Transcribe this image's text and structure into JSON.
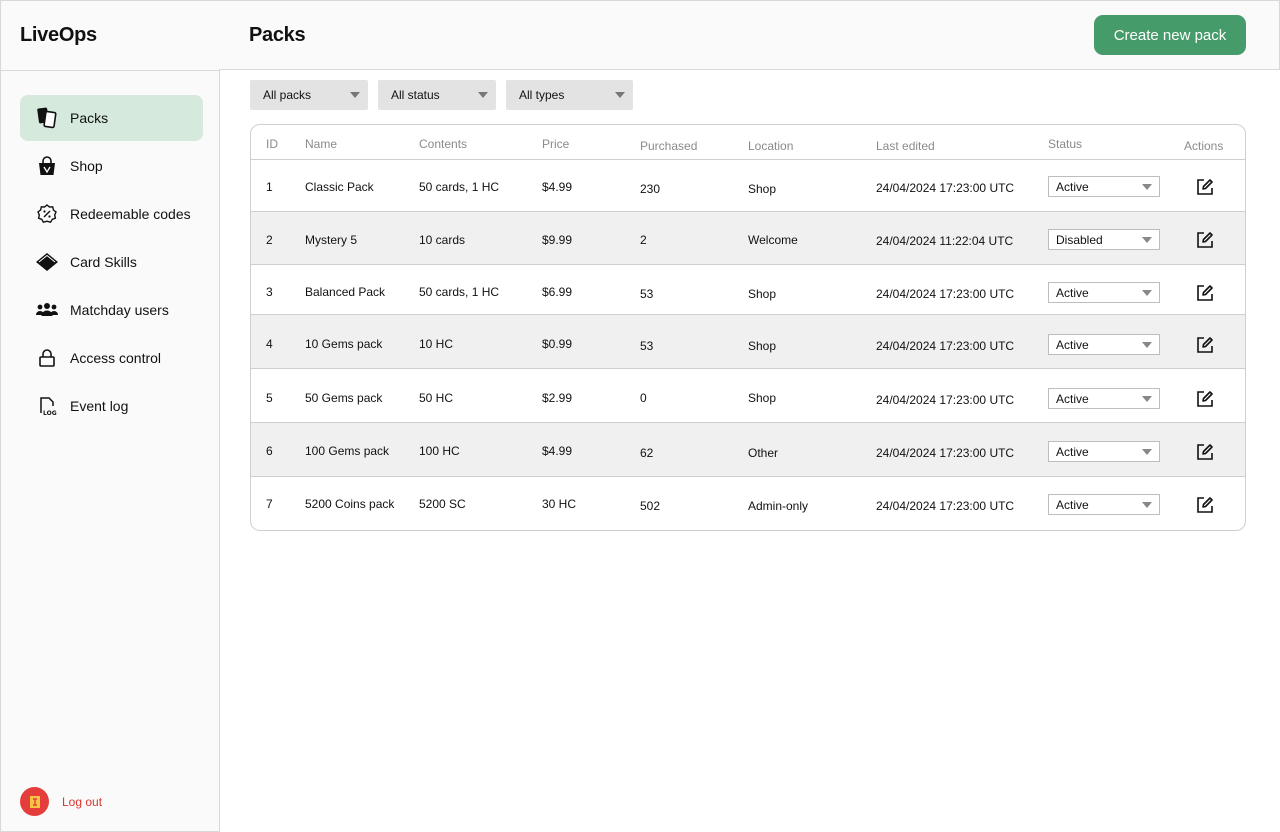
{
  "app": {
    "title": "LiveOps"
  },
  "sidebar": {
    "items": [
      {
        "label": "Packs",
        "icon": "cards-icon",
        "active": true
      },
      {
        "label": "Shop",
        "icon": "shopping-bag-icon",
        "active": false
      },
      {
        "label": "Redeemable codes",
        "icon": "discount-badge-icon",
        "active": false
      },
      {
        "label": "Card Skills",
        "icon": "diamond-icon",
        "active": false
      },
      {
        "label": "Matchday users",
        "icon": "users-icon",
        "active": false
      },
      {
        "label": "Access control",
        "icon": "lock-icon",
        "active": false
      },
      {
        "label": "Event log",
        "icon": "log-file-icon",
        "active": false
      }
    ],
    "logout_label": "Log out"
  },
  "header": {
    "title": "Packs",
    "create_button": "Create new pack"
  },
  "filters": [
    {
      "label": "All packs"
    },
    {
      "label": "All status"
    },
    {
      "label": "All types"
    }
  ],
  "table": {
    "columns": [
      "ID",
      "Name",
      "Contents",
      "Price",
      "Purchased",
      "Location",
      "Last edited",
      "Status",
      "Actions"
    ],
    "rows": [
      {
        "id": "1",
        "name": "Classic Pack",
        "contents": "50 cards, 1 HC",
        "price": "$4.99",
        "purchased": "230",
        "location": "Shop",
        "last_edited": "24/04/2024 17:23:00 UTC",
        "status": "Active"
      },
      {
        "id": "2",
        "name": "Mystery 5",
        "contents": "10 cards",
        "price": "$9.99",
        "purchased": "2",
        "location": "Welcome",
        "last_edited": "24/04/2024 11:22:04 UTC",
        "status": "Disabled"
      },
      {
        "id": "3",
        "name": "Balanced Pack",
        "contents": "50 cards, 1 HC",
        "price": "$6.99",
        "purchased": "53",
        "location": "Shop",
        "last_edited": "24/04/2024 17:23:00 UTC",
        "status": "Active"
      },
      {
        "id": "4",
        "name": "10 Gems pack",
        "contents": "10 HC",
        "price": "$0.99",
        "purchased": "53",
        "location": "Shop",
        "last_edited": "24/04/2024 17:23:00 UTC",
        "status": "Active"
      },
      {
        "id": "5",
        "name": "50 Gems pack",
        "contents": "50 HC",
        "price": "$2.99",
        "purchased": "0",
        "location": "Shop",
        "last_edited": "24/04/2024 17:23:00 UTC",
        "status": "Active"
      },
      {
        "id": "6",
        "name": "100 Gems pack",
        "contents": "100 HC",
        "price": "$4.99",
        "purchased": "62",
        "location": "Other",
        "last_edited": "24/04/2024 17:23:00 UTC",
        "status": "Active"
      },
      {
        "id": "7",
        "name": "5200 Coins pack",
        "contents": "5200 SC",
        "price": "30 HC",
        "purchased": "502",
        "location": "Admin-only",
        "last_edited": "24/04/2024 17:23:00 UTC",
        "status": "Active"
      }
    ]
  },
  "colors": {
    "accent": "#469b6a",
    "active_nav": "#d5e9dd",
    "logout": "#e53c3c"
  }
}
